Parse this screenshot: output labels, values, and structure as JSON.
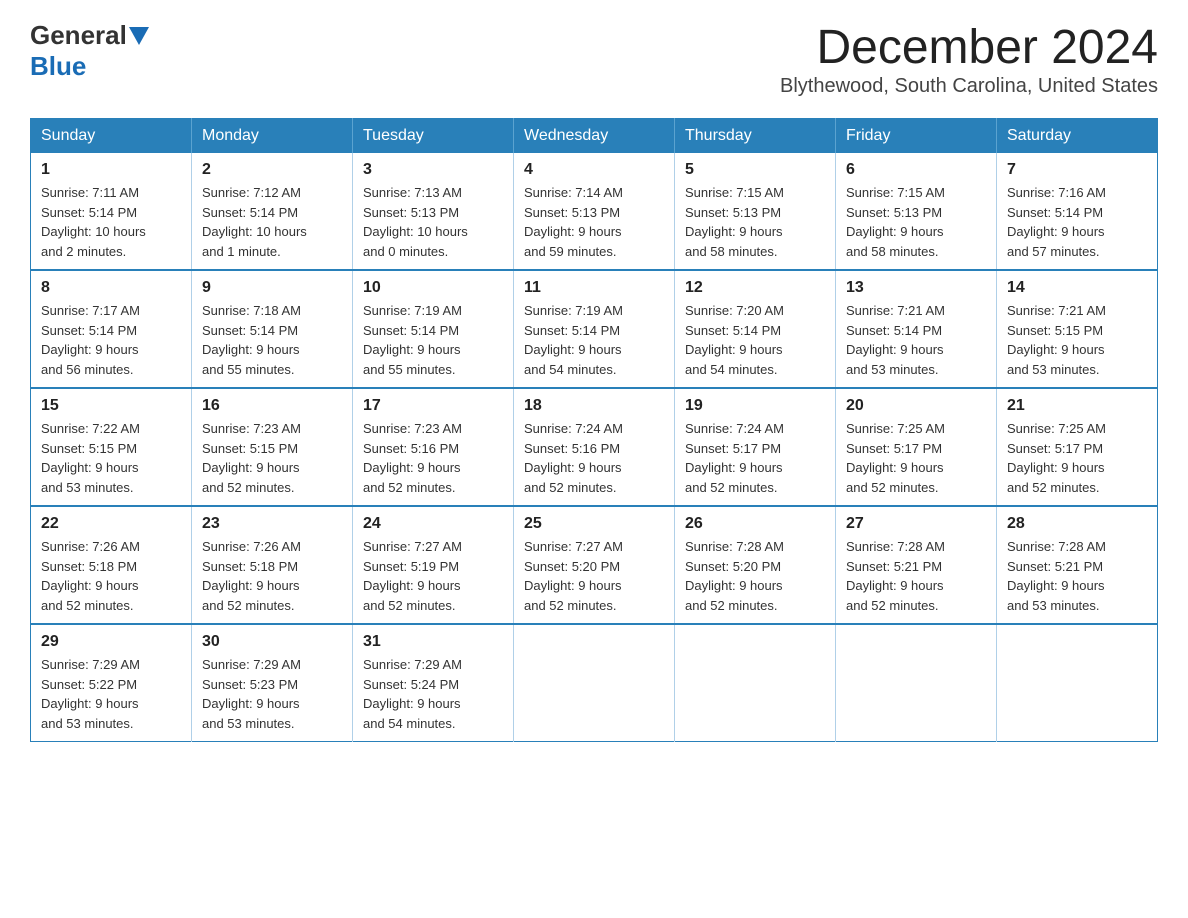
{
  "logo": {
    "general": "General",
    "blue": "Blue"
  },
  "header": {
    "month": "December 2024",
    "location": "Blythewood, South Carolina, United States"
  },
  "weekdays": [
    "Sunday",
    "Monday",
    "Tuesday",
    "Wednesday",
    "Thursday",
    "Friday",
    "Saturday"
  ],
  "weeks": [
    [
      {
        "day": "1",
        "sunrise": "7:11 AM",
        "sunset": "5:14 PM",
        "daylight": "10 hours and 2 minutes."
      },
      {
        "day": "2",
        "sunrise": "7:12 AM",
        "sunset": "5:14 PM",
        "daylight": "10 hours and 1 minute."
      },
      {
        "day": "3",
        "sunrise": "7:13 AM",
        "sunset": "5:13 PM",
        "daylight": "10 hours and 0 minutes."
      },
      {
        "day": "4",
        "sunrise": "7:14 AM",
        "sunset": "5:13 PM",
        "daylight": "9 hours and 59 minutes."
      },
      {
        "day": "5",
        "sunrise": "7:15 AM",
        "sunset": "5:13 PM",
        "daylight": "9 hours and 58 minutes."
      },
      {
        "day": "6",
        "sunrise": "7:15 AM",
        "sunset": "5:13 PM",
        "daylight": "9 hours and 58 minutes."
      },
      {
        "day": "7",
        "sunrise": "7:16 AM",
        "sunset": "5:14 PM",
        "daylight": "9 hours and 57 minutes."
      }
    ],
    [
      {
        "day": "8",
        "sunrise": "7:17 AM",
        "sunset": "5:14 PM",
        "daylight": "9 hours and 56 minutes."
      },
      {
        "day": "9",
        "sunrise": "7:18 AM",
        "sunset": "5:14 PM",
        "daylight": "9 hours and 55 minutes."
      },
      {
        "day": "10",
        "sunrise": "7:19 AM",
        "sunset": "5:14 PM",
        "daylight": "9 hours and 55 minutes."
      },
      {
        "day": "11",
        "sunrise": "7:19 AM",
        "sunset": "5:14 PM",
        "daylight": "9 hours and 54 minutes."
      },
      {
        "day": "12",
        "sunrise": "7:20 AM",
        "sunset": "5:14 PM",
        "daylight": "9 hours and 54 minutes."
      },
      {
        "day": "13",
        "sunrise": "7:21 AM",
        "sunset": "5:14 PM",
        "daylight": "9 hours and 53 minutes."
      },
      {
        "day": "14",
        "sunrise": "7:21 AM",
        "sunset": "5:15 PM",
        "daylight": "9 hours and 53 minutes."
      }
    ],
    [
      {
        "day": "15",
        "sunrise": "7:22 AM",
        "sunset": "5:15 PM",
        "daylight": "9 hours and 53 minutes."
      },
      {
        "day": "16",
        "sunrise": "7:23 AM",
        "sunset": "5:15 PM",
        "daylight": "9 hours and 52 minutes."
      },
      {
        "day": "17",
        "sunrise": "7:23 AM",
        "sunset": "5:16 PM",
        "daylight": "9 hours and 52 minutes."
      },
      {
        "day": "18",
        "sunrise": "7:24 AM",
        "sunset": "5:16 PM",
        "daylight": "9 hours and 52 minutes."
      },
      {
        "day": "19",
        "sunrise": "7:24 AM",
        "sunset": "5:17 PM",
        "daylight": "9 hours and 52 minutes."
      },
      {
        "day": "20",
        "sunrise": "7:25 AM",
        "sunset": "5:17 PM",
        "daylight": "9 hours and 52 minutes."
      },
      {
        "day": "21",
        "sunrise": "7:25 AM",
        "sunset": "5:17 PM",
        "daylight": "9 hours and 52 minutes."
      }
    ],
    [
      {
        "day": "22",
        "sunrise": "7:26 AM",
        "sunset": "5:18 PM",
        "daylight": "9 hours and 52 minutes."
      },
      {
        "day": "23",
        "sunrise": "7:26 AM",
        "sunset": "5:18 PM",
        "daylight": "9 hours and 52 minutes."
      },
      {
        "day": "24",
        "sunrise": "7:27 AM",
        "sunset": "5:19 PM",
        "daylight": "9 hours and 52 minutes."
      },
      {
        "day": "25",
        "sunrise": "7:27 AM",
        "sunset": "5:20 PM",
        "daylight": "9 hours and 52 minutes."
      },
      {
        "day": "26",
        "sunrise": "7:28 AM",
        "sunset": "5:20 PM",
        "daylight": "9 hours and 52 minutes."
      },
      {
        "day": "27",
        "sunrise": "7:28 AM",
        "sunset": "5:21 PM",
        "daylight": "9 hours and 52 minutes."
      },
      {
        "day": "28",
        "sunrise": "7:28 AM",
        "sunset": "5:21 PM",
        "daylight": "9 hours and 53 minutes."
      }
    ],
    [
      {
        "day": "29",
        "sunrise": "7:29 AM",
        "sunset": "5:22 PM",
        "daylight": "9 hours and 53 minutes."
      },
      {
        "day": "30",
        "sunrise": "7:29 AM",
        "sunset": "5:23 PM",
        "daylight": "9 hours and 53 minutes."
      },
      {
        "day": "31",
        "sunrise": "7:29 AM",
        "sunset": "5:24 PM",
        "daylight": "9 hours and 54 minutes."
      },
      null,
      null,
      null,
      null
    ]
  ],
  "labels": {
    "sunrise": "Sunrise:",
    "sunset": "Sunset:",
    "daylight": "Daylight:"
  }
}
